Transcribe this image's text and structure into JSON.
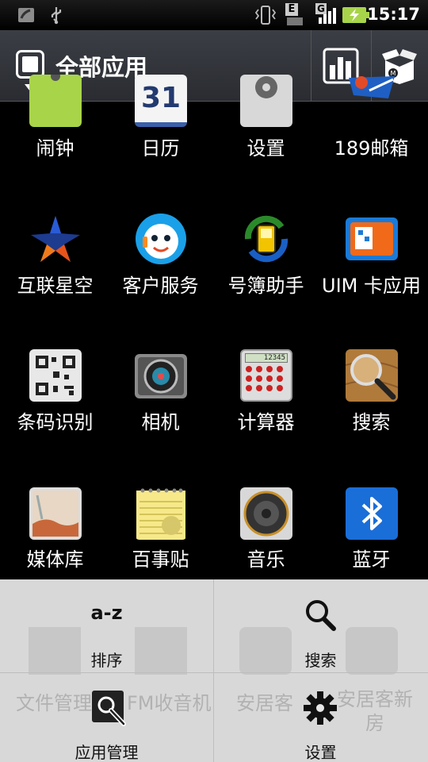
{
  "status_bar": {
    "time": "15:17",
    "network_letter_e": "E",
    "network_letter_g": "G",
    "icons": [
      "missed-call-icon",
      "usb-icon",
      "vibrate-icon",
      "signal-e-icon",
      "signal-g-icon",
      "battery-charging-icon"
    ]
  },
  "header": {
    "title": "全部应用"
  },
  "apps": [
    {
      "label": "闹钟",
      "icon": "alarm-clock-icon"
    },
    {
      "label": "日历",
      "icon": "calendar-icon",
      "badge": "31"
    },
    {
      "label": "设置",
      "icon": "settings-gear-icon"
    },
    {
      "label": "189邮箱",
      "icon": "mail-189-icon"
    },
    {
      "label": "互联星空",
      "icon": "star-icon"
    },
    {
      "label": "客户服务",
      "icon": "customer-service-icon"
    },
    {
      "label": "号簿助手",
      "icon": "contacts-sync-icon"
    },
    {
      "label": "UIM 卡应用",
      "icon": "sim-card-icon"
    },
    {
      "label": "条码识别",
      "icon": "qr-code-icon"
    },
    {
      "label": "相机",
      "icon": "camera-icon"
    },
    {
      "label": "计算器",
      "icon": "calculator-icon",
      "display": "12345"
    },
    {
      "label": "搜索",
      "icon": "search-magnifier-icon"
    },
    {
      "label": "媒体库",
      "icon": "gallery-icon"
    },
    {
      "label": "百事贴",
      "icon": "notepad-icon"
    },
    {
      "label": "音乐",
      "icon": "music-speaker-icon"
    },
    {
      "label": "蓝牙",
      "icon": "bluetooth-icon"
    }
  ],
  "background_apps": [
    {
      "label": "文件管理"
    },
    {
      "label": "FM收音机"
    },
    {
      "label": "安居客"
    },
    {
      "label": "安居客新房"
    }
  ],
  "menu": {
    "sort_icon_text": "a-z",
    "sort_label": "排序",
    "search_label": "搜索",
    "app_manage_label": "应用管理",
    "settings_label": "设置"
  },
  "colors": {
    "accent_green": "#a8d44a",
    "menu_bg": "#e8e8e8"
  }
}
